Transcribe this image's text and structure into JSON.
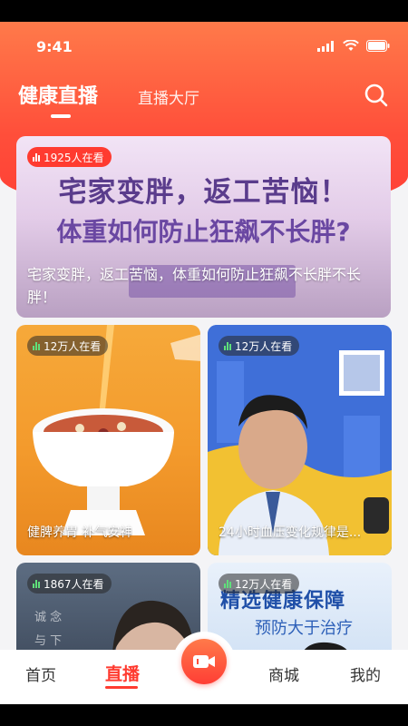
{
  "status_bar": {
    "time": "9:41"
  },
  "top_nav": {
    "active_tab": "健康直播",
    "other_tab": "直播大厅"
  },
  "hero": {
    "viewers": "1925人在看",
    "headline_1": "宅家变胖，返工苦恼！",
    "headline_2": "体重如何防止狂飙不长胖?",
    "description": "宅家变胖，返工苦恼，体重如何防止狂飙不长胖不长胖！"
  },
  "cards": [
    {
      "viewers": "12万人在看",
      "title": "健脾养胃 补气安神"
    },
    {
      "viewers": "12万人在看",
      "title": "24小时血压变化规律是..."
    },
    {
      "viewers": "1867人在看",
      "title": ""
    },
    {
      "viewers": "12万人在看",
      "title": "",
      "banner_1": "精选健康保障",
      "banner_2": "预防大于治疗"
    }
  ],
  "bottom_nav": {
    "home": "首页",
    "live": "直播",
    "mall": "商城",
    "mine": "我的"
  },
  "colors": {
    "accent": "#ff3b30",
    "header_gradient_top": "#ff7a4a",
    "header_gradient_bottom": "#ff3e35"
  }
}
